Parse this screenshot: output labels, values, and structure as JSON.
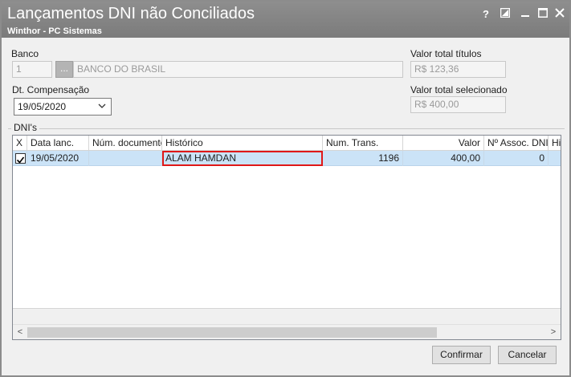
{
  "window": {
    "title": "Lançamentos DNI não Conciliados",
    "subtitle": "Winthor - PC Sistemas",
    "controls": [
      "?",
      "▣",
      "—",
      "☐",
      "✕"
    ]
  },
  "form": {
    "banco_label": "Banco",
    "banco_code": "1",
    "banco_lookup_label": "...",
    "banco_name": "BANCO DO BRASIL",
    "dt_compensacao_label": "Dt. Compensação",
    "dt_compensacao_value": "19/05/2020",
    "valor_total_titulos_label": "Valor total títulos",
    "valor_total_titulos_value": "R$ 123,36",
    "valor_total_selecionado_label": "Valor total selecionado",
    "valor_total_selecionado_value": "R$ 400,00"
  },
  "dnis": {
    "group_title": "DNI's",
    "columns": [
      "X",
      "Data lanc.",
      "Núm. documento",
      "Histórico",
      "Num. Trans.",
      "Valor",
      "Nº Assoc. DNI",
      "His"
    ],
    "rows": [
      {
        "checked": true,
        "data_lanc": "19/05/2020",
        "num_documento": "",
        "historico": "ALAM HAMDAN",
        "num_trans": "1196",
        "valor": "400,00",
        "assoc_dni": "0"
      }
    ]
  },
  "scrollbar": {
    "left_arrow": "<",
    "right_arrow": ">"
  },
  "buttons": {
    "confirmar": "Confirmar",
    "cancelar": "Cancelar"
  },
  "colors": {
    "titlebar": "#858585",
    "selected_row": "#cbe3f7",
    "highlight_border": "#e01818"
  }
}
